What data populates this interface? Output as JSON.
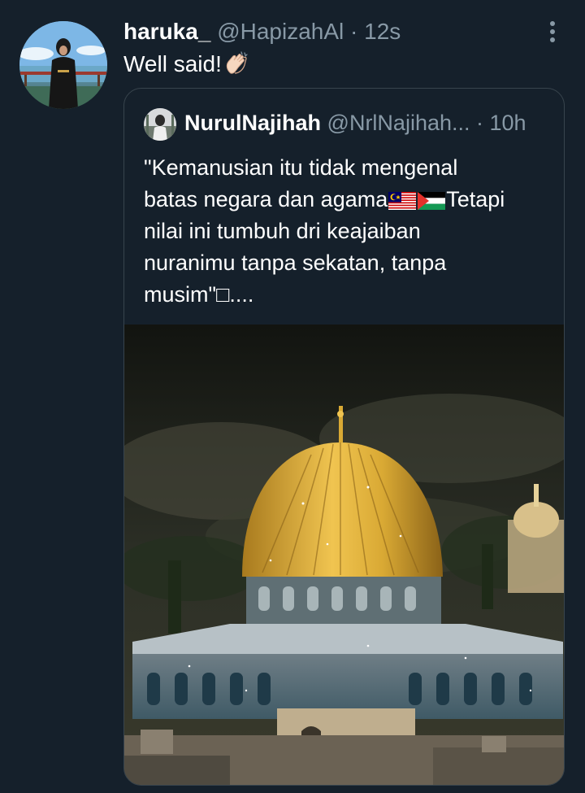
{
  "tweet": {
    "display_name": "haruka_",
    "handle": "@HapizahAl",
    "separator": " · ",
    "time": "12s",
    "text": "Well said!",
    "emoji": "clapping-hands"
  },
  "quoted_tweet": {
    "display_name": "NurulNajihah",
    "handle": "@NrlNajihah...",
    "separator": " · ",
    "time": "10h",
    "lines": [
      "\"Kemanusian itu tidak mengenal",
      "batas negara dan agama",
      "Tetapi",
      "nilai ini tumbuh dri keajaiban",
      "nuranimu tanpa sekatan, tanpa",
      "musim\"□...."
    ],
    "flags": [
      "malaysia-flag",
      "palestine-flag"
    ]
  },
  "colors": {
    "background": "#15202b",
    "border": "#38444d",
    "secondary_text": "#8899a6",
    "dome_gold": "#d9a934"
  }
}
